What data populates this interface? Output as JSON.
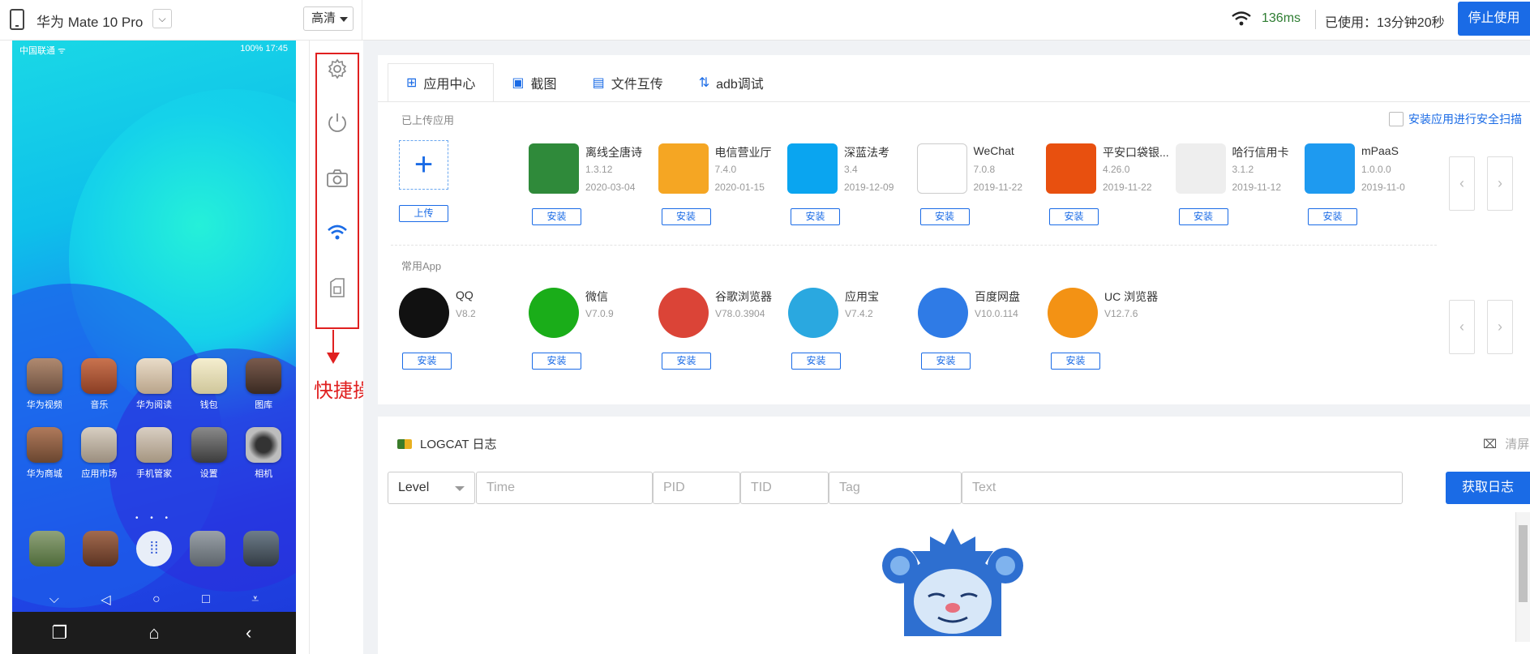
{
  "topbar": {
    "device_name": "华为 Mate 10 Pro",
    "quality": "高清",
    "ping": "136ms",
    "used_time": "已使用：13分钟20秒",
    "stop_label": "停止使用"
  },
  "phone": {
    "status_left": "中国联通 ᯤ",
    "status_right": "100% 17:45",
    "apps_row1": [
      "华为视频",
      "音乐",
      "华为阅读",
      "钱包",
      "图库"
    ],
    "apps_row2": [
      "华为商城",
      "应用市场",
      "手机管家",
      "设置",
      "相机"
    ]
  },
  "quick_actions": {
    "label": "快捷操作",
    "icons": [
      "gear-icon",
      "power-icon",
      "camera-icon",
      "wifi-icon",
      "sim-icon"
    ]
  },
  "tabs": [
    "应用中心",
    "截图",
    "文件互传",
    "adb调试"
  ],
  "uploaded_section": {
    "title": "已上传应用",
    "scan_label": "安装应用进行安全扫描",
    "upload_label": "上传",
    "install_label": "安装",
    "apps": [
      {
        "name": "离线全唐诗",
        "version": "1.3.12",
        "date": "2020-03-04",
        "color": "#2f8a3a"
      },
      {
        "name": "电信营业厅",
        "version": "7.4.0",
        "date": "2020-01-15",
        "color": "#f5a623"
      },
      {
        "name": "深蓝法考",
        "version": "3.4",
        "date": "2019-12-09",
        "color": "#0aa5f0"
      },
      {
        "name": "WeChat",
        "version": "7.0.8",
        "date": "2019-11-22",
        "color": "#ffffff"
      },
      {
        "name": "平安口袋银...",
        "version": "4.26.0",
        "date": "2019-11-22",
        "color": "#e8500f"
      },
      {
        "name": "哈行信用卡",
        "version": "3.1.2",
        "date": "2019-11-12",
        "color": "#eeeeee"
      },
      {
        "name": "mPaaS",
        "version": "1.0.0.0",
        "date": "2019-11-0",
        "color": "#1e9af0"
      }
    ]
  },
  "common_section": {
    "title": "常用App",
    "install_label": "安装",
    "apps": [
      {
        "name": "QQ",
        "version": "V8.2",
        "color": "#111111"
      },
      {
        "name": "微信",
        "version": "V7.0.9",
        "color": "#1aad19"
      },
      {
        "name": "谷歌浏览器",
        "version": "V78.0.3904",
        "color": "#db4437"
      },
      {
        "name": "应用宝",
        "version": "V7.4.2",
        "color": "#2aa8e0"
      },
      {
        "name": "百度网盘",
        "version": "V10.0.114",
        "color": "#2f7be6"
      },
      {
        "name": "UC 浏览器",
        "version": "V12.7.6",
        "color": "#f39214"
      }
    ]
  },
  "log": {
    "title": "LOGCAT 日志",
    "clear": "清屏",
    "level_value": "Level",
    "placeholders": {
      "time": "Time",
      "pid": "PID",
      "tid": "TID",
      "tag": "Tag",
      "text": "Text"
    },
    "fetch_label": "获取日志"
  }
}
